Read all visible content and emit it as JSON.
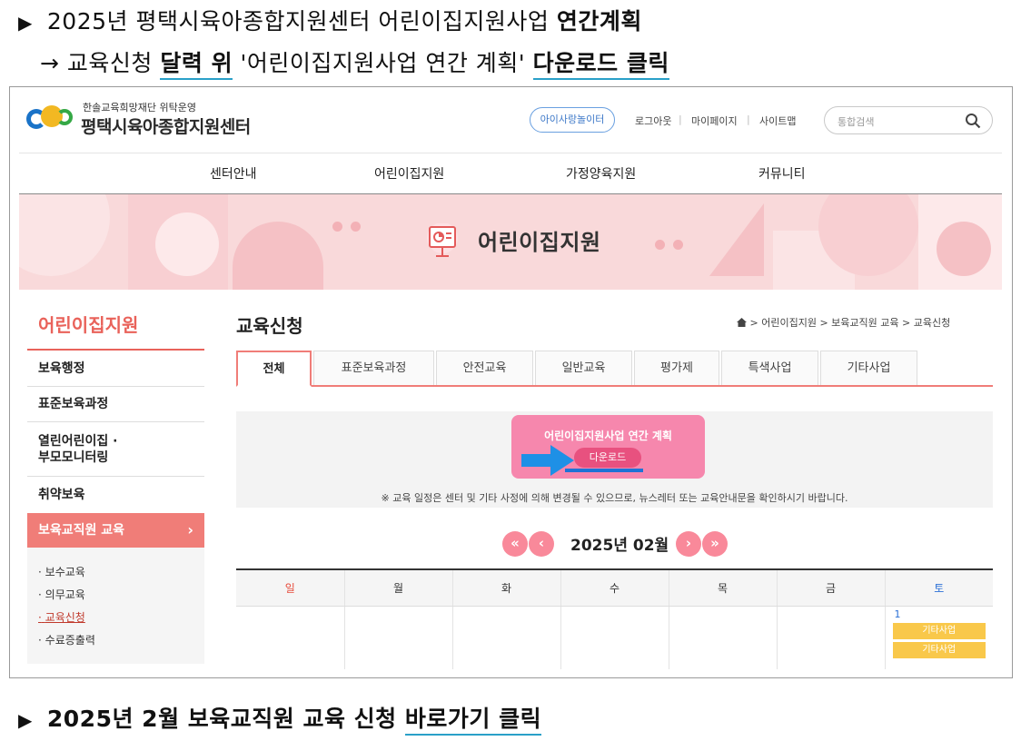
{
  "instructions": {
    "line1": {
      "prefix": "▶",
      "text": "2025년 평택시육아종합지원센터 어린이집지원사업 ",
      "bold": "연간계획"
    },
    "line2": {
      "prefix": "→",
      "text1": "교육신청 ",
      "link1": "달력 위",
      "text2": " '어린이집지원사업 연간 계획' ",
      "link2": "다운로드 클릭"
    },
    "line3": {
      "prefix": "▶",
      "text": "2025년 2월 보육교직원 교육 신청 ",
      "link": "바로가기 클릭"
    }
  },
  "header": {
    "logo_sub": "한솔교육희망재단 위탁운영",
    "logo_main": "평택시육아종합지원센터",
    "pill_button": "아이사랑놀이터",
    "util_links": [
      "로그아웃",
      "마이페이지",
      "사이트맵"
    ],
    "util_sep": "|",
    "search_placeholder": "통합검색"
  },
  "nav": [
    "센터안내",
    "어린이집지원",
    "가정양육지원",
    "커뮤니티"
  ],
  "banner": {
    "title": "어린이집지원"
  },
  "sidebar": {
    "title": "어린이집지원",
    "items": [
      "보육행정",
      "표준보육과정",
      "열린어린이집 · 부모모니터링",
      "취약보육"
    ],
    "active": "보육교직원 교육",
    "active_chevron": "›",
    "sub_items": [
      "보수교육",
      "의무교육",
      "교육신청",
      "수료증출력"
    ],
    "sub_bullet": "·"
  },
  "main": {
    "title": "교육신청",
    "breadcrumb": [
      "어린이집지원",
      "보육교직원 교육",
      "교육신청"
    ],
    "crumb_sep": ">",
    "tabs": [
      "전체",
      "표준보육과정",
      "안전교육",
      "일반교육",
      "평가제",
      "특색사업",
      "기타사업"
    ],
    "download_card_title": "어린이집지원사업 연간 계획",
    "download_button": "다운로드",
    "notice": "※ 교육 일정은 센터 및 기타 사정에 의해 변경될 수 있으므로, 뉴스레터 또는 교육안내문을 확인하시기 바랍니다.",
    "calendar": {
      "month": "2025년 02월",
      "nav": {
        "first": "«",
        "prev": "‹",
        "next": "›",
        "last": "»"
      },
      "weekdays": [
        "일",
        "월",
        "화",
        "수",
        "목",
        "금",
        "토"
      ],
      "first_day": "1",
      "events": [
        "기타사업",
        "기타사업"
      ]
    }
  },
  "colors": {
    "accent": "#f07d78",
    "download_card": "#f687ad",
    "event": "#f9c84a",
    "banner_bg": "#f9d9da"
  }
}
